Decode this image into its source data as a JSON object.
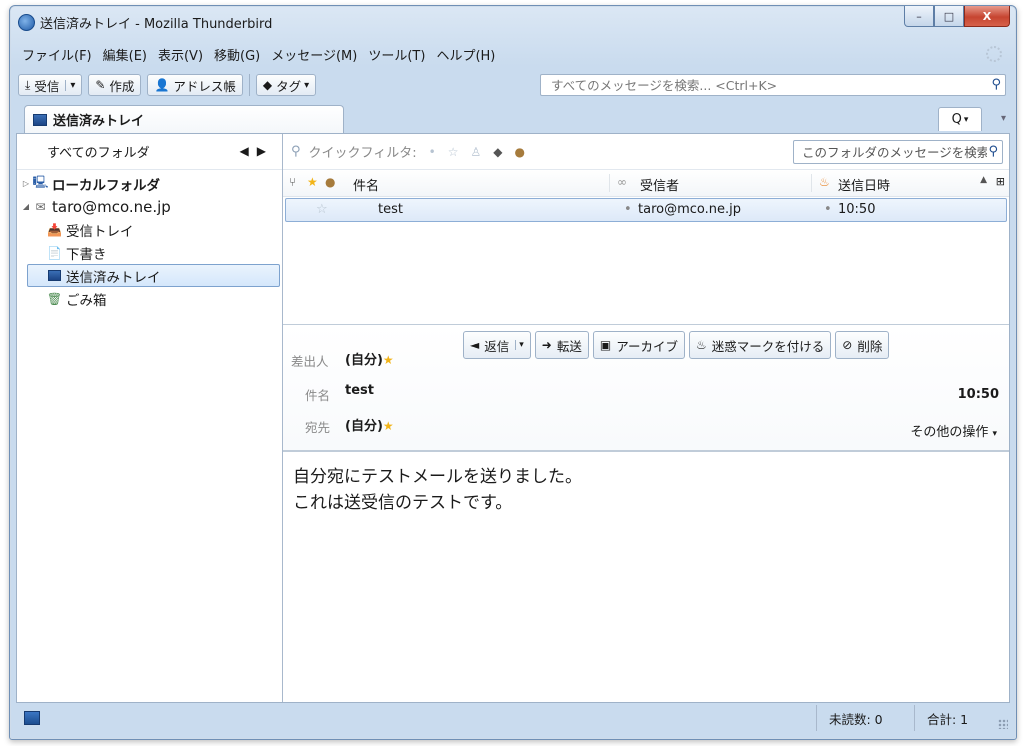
{
  "window": {
    "title": "送信済みトレイ - Mozilla Thunderbird",
    "controls": {
      "minimize": "–",
      "maximize": "□",
      "close": "X"
    }
  },
  "menubar": {
    "items": [
      "ファイル(F)",
      "編集(E)",
      "表示(V)",
      "移動(G)",
      "メッセージ(M)",
      "ツール(T)",
      "ヘルプ(H)"
    ]
  },
  "toolbar": {
    "get_messages": "受信",
    "write": "作成",
    "address_book": "アドレス帳",
    "tag": "タグ",
    "search_placeholder": "すべてのメッセージを検索... <Ctrl+K>"
  },
  "tabs": {
    "active": "送信済みトレイ",
    "menu_button": "Q"
  },
  "folder_pane": {
    "header": "すべてのフォルダ",
    "folders": [
      {
        "label": "ローカルフォルダ",
        "level": 1
      },
      {
        "label": "taro@mco.ne.jp",
        "level": 1
      },
      {
        "label": "受信トレイ",
        "level": 2
      },
      {
        "label": "下書き",
        "level": 2
      },
      {
        "label": "送信済みトレイ",
        "level": 2,
        "selected": true
      },
      {
        "label": "ごみ箱",
        "level": 2
      }
    ]
  },
  "quick_filter": {
    "label": "クイックフィルタ:",
    "search_placeholder": "このフォルダのメッセージを検索"
  },
  "thread_columns": {
    "subject": "件名",
    "recipient": "受信者",
    "date": "送信日時"
  },
  "messages": [
    {
      "subject": "test",
      "recipient": "taro@mco.ne.jp",
      "date": "10:50",
      "selected": true
    }
  ],
  "message_header": {
    "buttons": {
      "reply": "返信",
      "forward": "転送",
      "archive": "アーカイブ",
      "junk": "迷惑マークを付ける",
      "delete": "削除"
    },
    "from_label": "差出人",
    "from_value": "(自分)",
    "subject_label": "件名",
    "subject_value": "test",
    "to_label": "宛先",
    "to_value": "(自分)",
    "time": "10:50",
    "other_actions": "その他の操作"
  },
  "message_body": {
    "lines": [
      "自分宛にテストメールを送りました。",
      "これは送受信のテストです。"
    ]
  },
  "statusbar": {
    "unread": "未読数: 0",
    "total": "合計: 1"
  },
  "colors": {
    "accent": "#1f4d8f",
    "selection": "#dde9f8",
    "star": "#f2b418",
    "chrome": "#c9dbee"
  }
}
